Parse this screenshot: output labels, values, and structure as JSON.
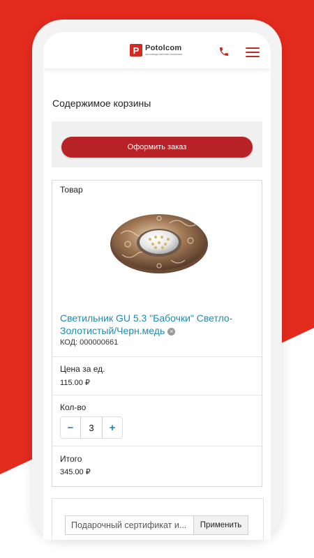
{
  "brand": {
    "logo_letter": "P",
    "name": "Potolcom",
    "tagline": "производственная компания",
    "accent_color": "#b82327",
    "background_red": "#e32b1e",
    "link_color": "#1e8bb0"
  },
  "header": {
    "phone_icon": "phone-icon",
    "menu_icon": "hamburger-menu-icon"
  },
  "cart": {
    "title": "Содержимое корзины",
    "checkout_label": "Оформить заказ",
    "item": {
      "product_header": "Товар",
      "product_name": "Светильник GU 5.3 \"Бабочки\" Светло-Золотистый/Черн.медь",
      "code": "КОД: 000000661",
      "price_label": "Цена за ед.",
      "price_value": "115.00 ₽",
      "qty_label": "Кол-во",
      "qty_minus": "−",
      "qty_value": "3",
      "qty_plus": "+",
      "total_label": "Итого",
      "total_value": "345.00 ₽"
    },
    "gift": {
      "input_text": "Подарочный сертификат и...",
      "apply_label": "Применить"
    }
  }
}
